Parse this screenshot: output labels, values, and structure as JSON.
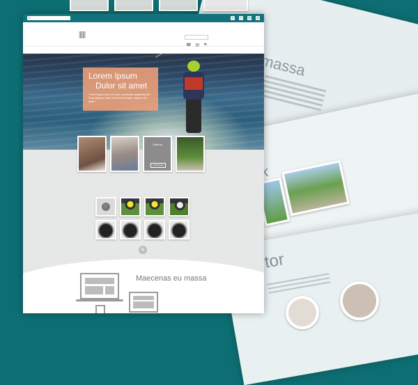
{
  "hero": {
    "title_line1": "Lorem Ipsum",
    "title_line2": "Dulor sit amet",
    "text": "\"Lorem ipsum dolor sit amet, consectetur adipiscing elit. Proin aliquam, dolor uma lorem tristique, aliquam dur amet.\""
  },
  "cards": [
    {
      "title": "",
      "text": ""
    },
    {
      "title": "",
      "text": ""
    },
    {
      "title": "Ceterus",
      "text": "",
      "button": "Lorem Ipsum"
    },
    {
      "title": "",
      "text": ""
    }
  ],
  "section": {
    "title": "Maecenas eu massa"
  },
  "background": {
    "title_massa": "massa",
    "title_rtor": "rtor",
    "title_k": "k"
  },
  "icons": [
    "search-icon",
    "facebook-icon",
    "twitter-icon",
    "instagram-icon",
    "pinterest-icon",
    "phone-icon",
    "chat-icon",
    "cart-icon",
    "plus-icon"
  ]
}
